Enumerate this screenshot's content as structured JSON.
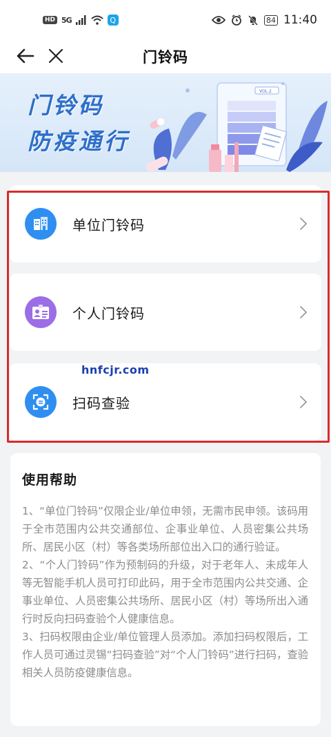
{
  "status_bar": {
    "left_badge": "HD",
    "network": "5G",
    "time": "11:40",
    "battery": "84",
    "icons": [
      "wifi-icon",
      "app-search-icon",
      "eye-icon",
      "alarm-icon",
      "mute-icon"
    ]
  },
  "nav": {
    "title": "门铃码",
    "icons": [
      "back-arrow-icon",
      "close-icon"
    ]
  },
  "banner": {
    "line1": "门铃码",
    "line2": "防疫通行",
    "badge_text": "VOL.2"
  },
  "menu": {
    "items": [
      {
        "label": "单位门铃码",
        "icon": "building-icon",
        "icon_color": "#2f8ff1"
      },
      {
        "label": "个人门铃码",
        "icon": "id-card-icon",
        "icon_color": "#9b6ee6"
      },
      {
        "label": "扫码查验",
        "icon": "scan-icon",
        "icon_color": "#2f8ff1"
      }
    ]
  },
  "watermark": "hnfcjr.com",
  "help": {
    "title": "使用帮助",
    "items": [
      "1、“单位门铃码”仅限企业/单位申领，无需市民申领。该码用于全市范围内公共交通部位、企事业单位、人员密集公共场所、居民小区（村）等各类场所部位出入口的通行验证。",
      "2、“个人门铃码”作为预制码的升级，对于老年人、未成年人等无智能手机人员可打印此码，用于全市范围内公共交通、企事业单位、人员密集公共场所、居民小区（村）等场所出入通行时反向扫码查验个人健康信息。",
      "3、扫码权限由企业/单位管理人员添加。添加扫码权限后，工作人员可通过灵锡“扫码查验”对“个人门铃码”进行扫码，查验相关人员防疫健康信息。"
    ]
  },
  "colors": {
    "accent_blue": "#2f8ff1",
    "accent_purple": "#9b6ee6",
    "highlight_red": "#d92b2b",
    "banner_text": "#2e6fc9"
  }
}
